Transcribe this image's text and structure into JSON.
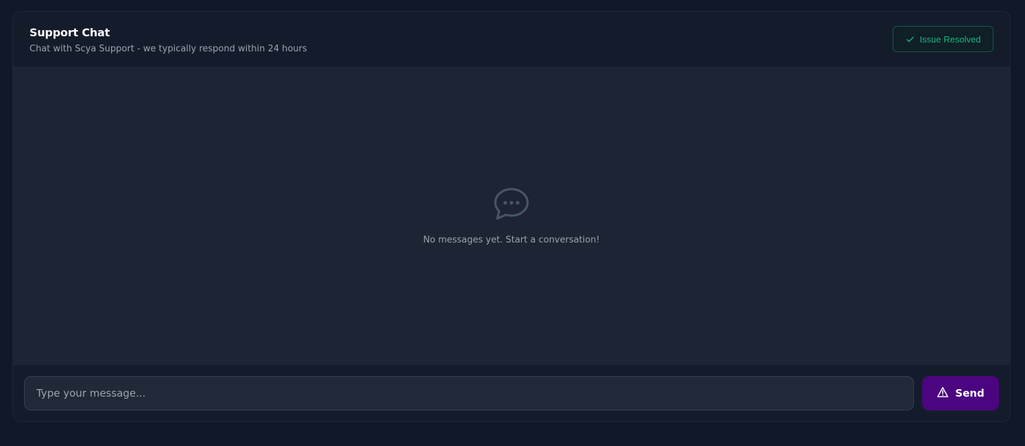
{
  "header": {
    "title": "Support Chat",
    "subtitle": "Chat with Scya Support - we typically respond within 24 hours",
    "resolved_label": "Issue Resolved"
  },
  "messages": {
    "empty_icon": "chat-bubble-icon",
    "empty_text": "No messages yet. Start a conversation!"
  },
  "composer": {
    "placeholder": "Type your message...",
    "value": "",
    "send_label": "Send",
    "send_icon": "warning-triangle-icon"
  },
  "colors": {
    "background": "#111827",
    "success": "#10b981",
    "send_button": "#4c0580"
  }
}
